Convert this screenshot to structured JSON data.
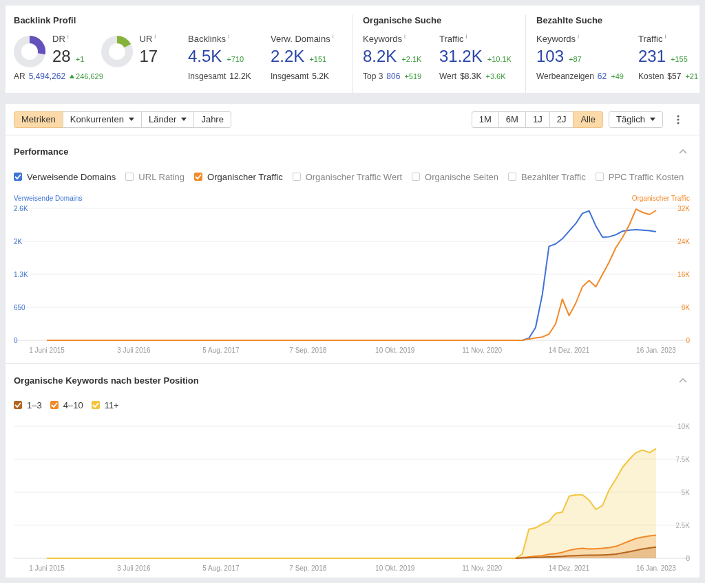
{
  "backlink_profile": {
    "title": "Backlink Profil",
    "ratings": [
      {
        "label": "DR",
        "hint": "i",
        "value": "28",
        "delta": "+1",
        "color": "#6650bd"
      },
      {
        "label": "UR",
        "hint": "i",
        "value": "17",
        "color": "#86b23a"
      }
    ],
    "ar": {
      "label": "AR",
      "value": "5,494,262",
      "delta": "246,629"
    },
    "metrics": [
      {
        "label": "Backlinks",
        "hint": "i",
        "value": "4.5K",
        "delta": "+710",
        "sub_label": "Insgesamt",
        "sub_value": "12.2K",
        "sub_link": false
      },
      {
        "label": "Verw. Domains",
        "hint": "i",
        "value": "2.2K",
        "delta": "+151",
        "sub_label": "Insgesamt",
        "sub_value": "5.2K",
        "sub_link": false
      }
    ]
  },
  "organic_search": {
    "title": "Organische Suche",
    "metrics": [
      {
        "label": "Keywords",
        "hint": "i",
        "value": "8.2K",
        "delta": "+2.1K",
        "sub_label": "Top 3",
        "sub_value": "806",
        "sub_link": true,
        "sub_delta": "+519"
      },
      {
        "label": "Traffic",
        "hint": "i",
        "value": "31.2K",
        "delta": "+10.1K",
        "sub_label": "Wert",
        "sub_value": "$8.3K",
        "sub_link": false,
        "sub_delta": "+3.6K"
      }
    ]
  },
  "paid_search": {
    "title": "Bezahlte Suche",
    "metrics": [
      {
        "label": "Keywords",
        "hint": "i",
        "value": "103",
        "delta": "+87",
        "sub_label": "Werbeanzeigen",
        "sub_value": "62",
        "sub_link": true,
        "sub_delta": "+49"
      },
      {
        "label": "Traffic",
        "hint": "i",
        "value": "231",
        "delta": "+155",
        "sub_label": "Kosten",
        "sub_value": "$57",
        "sub_link": false,
        "sub_delta": "+21"
      }
    ]
  },
  "toolbar": {
    "view_tabs": [
      {
        "label": "Metriken",
        "selected": true,
        "dropdown": false
      },
      {
        "label": "Konkurrenten",
        "selected": false,
        "dropdown": true
      },
      {
        "label": "Länder",
        "selected": false,
        "dropdown": true
      },
      {
        "label": "Jahre",
        "selected": false,
        "dropdown": false
      }
    ],
    "ranges": [
      {
        "label": "1M",
        "selected": false
      },
      {
        "label": "6M",
        "selected": false
      },
      {
        "label": "1J",
        "selected": false
      },
      {
        "label": "2J",
        "selected": false
      },
      {
        "label": "Alle",
        "selected": true
      }
    ],
    "interval": "Täglich"
  },
  "performance": {
    "title": "Performance",
    "expanded": true,
    "legend": [
      {
        "label": "Verweisende Domains",
        "checked": true,
        "color": "#3f73d6"
      },
      {
        "label": "URL Rating",
        "checked": false
      },
      {
        "label": "Organischer Traffic",
        "checked": true,
        "color": "#f28a2a"
      },
      {
        "label": "Organischer Traffic Wert",
        "checked": false
      },
      {
        "label": "Organische Seiten",
        "checked": false
      },
      {
        "label": "Bezahlter Traffic",
        "checked": false
      },
      {
        "label": "PPC Traffic Kosten",
        "checked": false
      }
    ],
    "chart_data": {
      "type": "line",
      "grid": true,
      "ylabel": "Verweisende Domains",
      "y2label": "Organischer Traffic",
      "categories": [
        "1 Juni 2015",
        null,
        null,
        null,
        null,
        null,
        null,
        null,
        null,
        null,
        null,
        null,
        null,
        "3 Juli 2016",
        null,
        null,
        null,
        null,
        null,
        null,
        null,
        null,
        null,
        null,
        null,
        null,
        "5 Aug. 2017",
        null,
        null,
        null,
        null,
        null,
        null,
        null,
        null,
        null,
        null,
        null,
        null,
        "7 Sep. 2018",
        null,
        null,
        null,
        null,
        null,
        null,
        null,
        null,
        null,
        null,
        null,
        null,
        "10 Okt. 2019",
        null,
        null,
        null,
        null,
        null,
        null,
        null,
        null,
        null,
        null,
        null,
        null,
        "11 Nov. 2020",
        null,
        null,
        null,
        null,
        null,
        null,
        null,
        null,
        null,
        null,
        null,
        null,
        "14 Dez. 2021",
        null,
        null,
        null,
        null,
        null,
        null,
        null,
        null,
        null,
        null,
        null,
        null,
        "16 Jan. 2023"
      ],
      "ylim": [
        0,
        2600
      ],
      "yticks": [
        0,
        650,
        {
          "value": 1300,
          "label": "1.3K"
        },
        {
          "value": 1950,
          "label": "2K"
        },
        {
          "value": 2600,
          "label": "2.6K"
        }
      ],
      "y2lim": [
        0,
        32000
      ],
      "y2ticks": [
        0,
        {
          "value": 8000,
          "label": "8K"
        },
        {
          "value": 16000,
          "label": "16K"
        },
        {
          "value": 24000,
          "label": "24K"
        },
        {
          "value": 32000,
          "label": "32K"
        }
      ],
      "series": [
        {
          "color": "#3f73d6",
          "axis": "y",
          "values": [
            null,
            null,
            null,
            null,
            null,
            null,
            null,
            null,
            null,
            null,
            null,
            null,
            null,
            null,
            null,
            null,
            null,
            null,
            null,
            null,
            null,
            null,
            null,
            null,
            null,
            null,
            null,
            null,
            null,
            null,
            null,
            null,
            null,
            null,
            null,
            null,
            null,
            null,
            null,
            null,
            null,
            null,
            null,
            null,
            null,
            null,
            null,
            null,
            null,
            null,
            null,
            null,
            null,
            null,
            null,
            null,
            null,
            null,
            null,
            null,
            null,
            null,
            null,
            null,
            null,
            null,
            null,
            null,
            null,
            null,
            0,
            0,
            40,
            250,
            900,
            1850,
            1900,
            2000,
            2150,
            2300,
            2500,
            2550,
            2250,
            2030,
            2040,
            2080,
            2150,
            2170,
            2180,
            2170,
            2160,
            2140
          ]
        },
        {
          "color": "#f28a2a",
          "axis": "y2",
          "values": [
            0,
            0,
            0,
            0,
            0,
            0,
            0,
            0,
            0,
            0,
            0,
            0,
            0,
            0,
            0,
            0,
            0,
            0,
            0,
            0,
            0,
            0,
            0,
            0,
            0,
            0,
            0,
            0,
            0,
            0,
            0,
            0,
            0,
            0,
            0,
            0,
            0,
            0,
            0,
            0,
            0,
            0,
            0,
            0,
            0,
            0,
            0,
            0,
            0,
            0,
            0,
            0,
            0,
            0,
            0,
            0,
            0,
            0,
            0,
            0,
            0,
            0,
            0,
            0,
            0,
            0,
            0,
            0,
            0,
            0,
            0,
            0,
            300,
            600,
            800,
            1500,
            4000,
            10000,
            6000,
            9000,
            13000,
            14500,
            13000,
            16000,
            19000,
            22500,
            25000,
            28000,
            31800,
            31000,
            30500,
            31500
          ]
        }
      ]
    }
  },
  "keywords_by_position": {
    "title": "Organische Keywords nach bester Position",
    "expanded": true,
    "legend": [
      {
        "label": "1–3",
        "checked": true,
        "color": "#b5651d"
      },
      {
        "label": "4–10",
        "checked": true,
        "color": "#f28a2a"
      },
      {
        "label": "11+",
        "checked": true,
        "color": "#f2c53d"
      }
    ],
    "chart_data": {
      "type": "area",
      "grid": true,
      "categories": [
        "1 Juni 2015",
        null,
        null,
        null,
        null,
        null,
        null,
        null,
        null,
        null,
        null,
        null,
        null,
        "3 Juli 2016",
        null,
        null,
        null,
        null,
        null,
        null,
        null,
        null,
        null,
        null,
        null,
        null,
        "5 Aug. 2017",
        null,
        null,
        null,
        null,
        null,
        null,
        null,
        null,
        null,
        null,
        null,
        null,
        "7 Sep. 2018",
        null,
        null,
        null,
        null,
        null,
        null,
        null,
        null,
        null,
        null,
        null,
        null,
        "10 Okt. 2019",
        null,
        null,
        null,
        null,
        null,
        null,
        null,
        null,
        null,
        null,
        null,
        null,
        "11 Nov. 2020",
        null,
        null,
        null,
        null,
        null,
        null,
        null,
        null,
        null,
        null,
        null,
        null,
        "14 Dez. 2021",
        null,
        null,
        null,
        null,
        null,
        null,
        null,
        null,
        null,
        null,
        null,
        null,
        "16 Jan. 2023"
      ],
      "y2lim": [
        0,
        10000
      ],
      "y2ticks": [
        0,
        {
          "value": 2500,
          "label": "2.5K"
        },
        {
          "value": 5000,
          "label": "5K"
        },
        {
          "value": 7500,
          "label": "7.5K"
        },
        {
          "value": 10000,
          "label": "10K"
        }
      ],
      "series": [
        {
          "color": "#b5651d",
          "axis": "y2",
          "values": [
            null,
            null,
            null,
            null,
            null,
            null,
            null,
            null,
            null,
            null,
            null,
            null,
            null,
            null,
            null,
            null,
            null,
            null,
            null,
            null,
            null,
            null,
            null,
            null,
            null,
            null,
            null,
            null,
            null,
            null,
            null,
            null,
            null,
            null,
            null,
            null,
            null,
            null,
            null,
            null,
            null,
            null,
            null,
            null,
            null,
            null,
            null,
            null,
            null,
            null,
            null,
            null,
            null,
            null,
            null,
            null,
            null,
            null,
            null,
            null,
            null,
            null,
            null,
            null,
            null,
            null,
            null,
            null,
            null,
            null,
            0,
            20,
            40,
            60,
            80,
            100,
            120,
            140,
            180,
            200,
            220,
            230,
            240,
            250,
            270,
            320,
            400,
            500,
            600,
            700,
            780,
            850
          ]
        },
        {
          "color": "#f28a2a",
          "axis": "y2",
          "values": [
            null,
            null,
            null,
            null,
            null,
            null,
            null,
            null,
            null,
            null,
            null,
            null,
            null,
            null,
            null,
            null,
            null,
            null,
            null,
            null,
            null,
            null,
            null,
            null,
            null,
            null,
            null,
            null,
            null,
            null,
            null,
            null,
            null,
            null,
            null,
            null,
            null,
            null,
            null,
            null,
            null,
            null,
            null,
            null,
            null,
            null,
            null,
            null,
            null,
            null,
            null,
            null,
            null,
            null,
            null,
            null,
            null,
            null,
            null,
            null,
            null,
            null,
            null,
            null,
            null,
            null,
            null,
            null,
            null,
            null,
            0,
            50,
            100,
            150,
            200,
            300,
            350,
            450,
            600,
            700,
            750,
            700,
            720,
            750,
            800,
            900,
            1100,
            1300,
            1500,
            1600,
            1700,
            1750
          ]
        },
        {
          "color": "#f2c53d",
          "axis": "y2",
          "values": [
            0,
            0,
            0,
            0,
            0,
            0,
            0,
            0,
            0,
            0,
            0,
            0,
            0,
            0,
            0,
            0,
            0,
            0,
            0,
            0,
            0,
            0,
            0,
            0,
            0,
            0,
            0,
            0,
            0,
            0,
            0,
            0,
            0,
            0,
            0,
            0,
            0,
            0,
            0,
            0,
            0,
            0,
            0,
            0,
            0,
            0,
            0,
            0,
            0,
            0,
            0,
            0,
            0,
            0,
            0,
            0,
            0,
            0,
            0,
            0,
            0,
            0,
            0,
            0,
            0,
            0,
            0,
            0,
            0,
            0,
            0,
            300,
            2200,
            2300,
            2600,
            2800,
            3400,
            3500,
            4700,
            4800,
            4800,
            4400,
            3700,
            4000,
            5200,
            6000,
            6900,
            7500,
            8000,
            8200,
            8000,
            8300
          ]
        }
      ]
    }
  }
}
